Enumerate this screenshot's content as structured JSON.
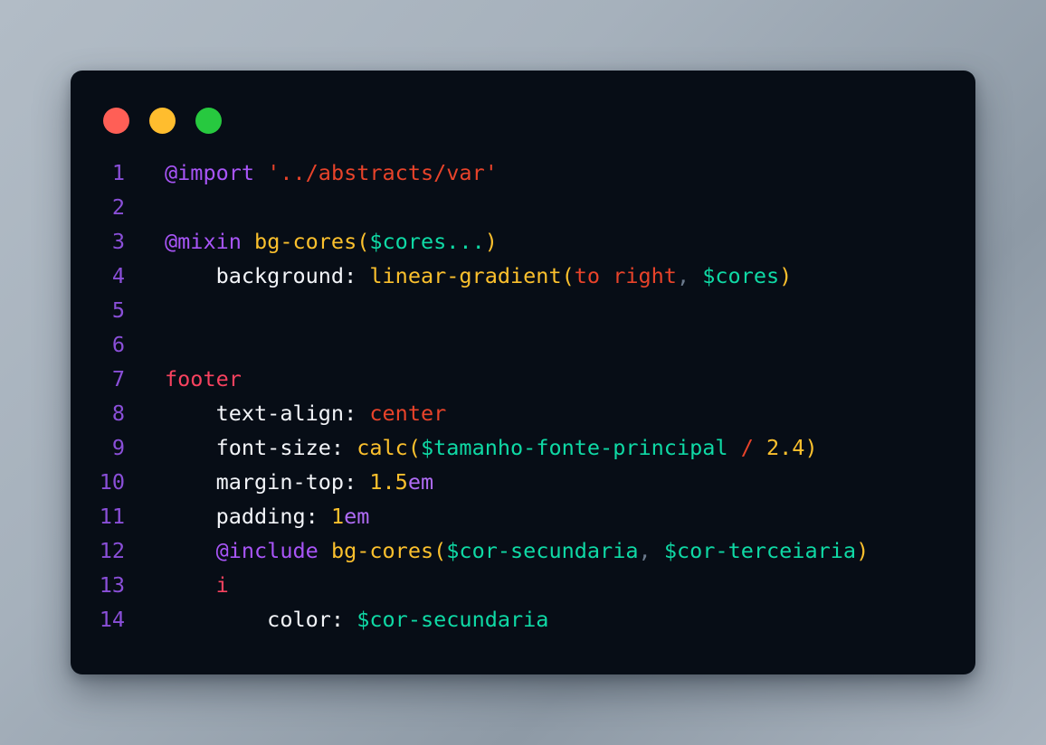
{
  "window": {
    "dots": [
      {
        "name": "close-dot",
        "color": "#ff5f56"
      },
      {
        "name": "minimize-dot",
        "color": "#ffbd2e"
      },
      {
        "name": "maximize-dot",
        "color": "#27c93f"
      }
    ],
    "background_color": "#070d16",
    "page_background": "#a6b1bc"
  },
  "editor": {
    "language": "scss",
    "line_count": 14,
    "line_numbers": [
      "1",
      "2",
      "3",
      "4",
      "5",
      "6",
      "7",
      "8",
      "9",
      "10",
      "11",
      "12",
      "13",
      "14"
    ],
    "lines": [
      {
        "number": "1",
        "text": "@import '../abstracts/var'",
        "tokens": [
          {
            "t": "@import",
            "c": "t-at"
          },
          {
            "t": " ",
            "c": "t-plain"
          },
          {
            "t": "'../abstracts/var'",
            "c": "t-str"
          }
        ]
      },
      {
        "number": "2",
        "text": "",
        "tokens": []
      },
      {
        "number": "3",
        "text": "@mixin bg-cores($cores...)",
        "tokens": [
          {
            "t": "@mixin",
            "c": "t-at"
          },
          {
            "t": " ",
            "c": "t-plain"
          },
          {
            "t": "bg-cores",
            "c": "t-fn"
          },
          {
            "t": "(",
            "c": "t-punct"
          },
          {
            "t": "$cores...",
            "c": "t-var"
          },
          {
            "t": ")",
            "c": "t-punct"
          }
        ]
      },
      {
        "number": "4",
        "text": "    background: linear-gradient(to right, $cores)",
        "tokens": [
          {
            "t": "    background: ",
            "c": "t-plain"
          },
          {
            "t": "linear-gradient",
            "c": "t-fn"
          },
          {
            "t": "(",
            "c": "t-punct"
          },
          {
            "t": "to right",
            "c": "t-val"
          },
          {
            "t": ",",
            "c": "t-comma"
          },
          {
            "t": " ",
            "c": "t-plain"
          },
          {
            "t": "$cores",
            "c": "t-var"
          },
          {
            "t": ")",
            "c": "t-punct"
          }
        ]
      },
      {
        "number": "5",
        "text": "",
        "tokens": []
      },
      {
        "number": "6",
        "text": "",
        "tokens": []
      },
      {
        "number": "7",
        "text": "footer",
        "tokens": [
          {
            "t": "footer",
            "c": "t-sel"
          }
        ]
      },
      {
        "number": "8",
        "text": "    text-align: center",
        "tokens": [
          {
            "t": "    text-align: ",
            "c": "t-plain"
          },
          {
            "t": "center",
            "c": "t-val"
          }
        ]
      },
      {
        "number": "9",
        "text": "    font-size: calc($tamanho-fonte-principal / 2.4)",
        "tokens": [
          {
            "t": "    font-size: ",
            "c": "t-plain"
          },
          {
            "t": "calc",
            "c": "t-fn"
          },
          {
            "t": "(",
            "c": "t-punct"
          },
          {
            "t": "$tamanho-fonte-principal",
            "c": "t-var"
          },
          {
            "t": " ",
            "c": "t-plain"
          },
          {
            "t": "/",
            "c": "t-op"
          },
          {
            "t": " ",
            "c": "t-plain"
          },
          {
            "t": "2.4",
            "c": "t-num"
          },
          {
            "t": ")",
            "c": "t-punct"
          }
        ]
      },
      {
        "number": "10",
        "text": "    margin-top: 1.5em",
        "tokens": [
          {
            "t": "    margin-top: ",
            "c": "t-plain"
          },
          {
            "t": "1.5",
            "c": "t-num"
          },
          {
            "t": "em",
            "c": "t-unit"
          }
        ]
      },
      {
        "number": "11",
        "text": "    padding: 1em",
        "tokens": [
          {
            "t": "    padding: ",
            "c": "t-plain"
          },
          {
            "t": "1",
            "c": "t-num"
          },
          {
            "t": "em",
            "c": "t-unit"
          }
        ]
      },
      {
        "number": "12",
        "text": "    @include bg-cores($cor-secundaria, $cor-terceiaria)",
        "tokens": [
          {
            "t": "    ",
            "c": "t-plain"
          },
          {
            "t": "@include",
            "c": "t-at"
          },
          {
            "t": " ",
            "c": "t-plain"
          },
          {
            "t": "bg-cores",
            "c": "t-fn"
          },
          {
            "t": "(",
            "c": "t-punct"
          },
          {
            "t": "$cor-secundaria",
            "c": "t-var"
          },
          {
            "t": ",",
            "c": "t-comma"
          },
          {
            "t": " ",
            "c": "t-plain"
          },
          {
            "t": "$cor-terceiaria",
            "c": "t-var"
          },
          {
            "t": ")",
            "c": "t-punct"
          }
        ]
      },
      {
        "number": "13",
        "text": "    i",
        "tokens": [
          {
            "t": "    ",
            "c": "t-plain"
          },
          {
            "t": "i",
            "c": "t-sel"
          }
        ]
      },
      {
        "number": "14",
        "text": "        color: $cor-secundaria",
        "tokens": [
          {
            "t": "        color: ",
            "c": "t-plain"
          },
          {
            "t": "$cor-secundaria",
            "c": "t-var"
          }
        ]
      }
    ],
    "token_colors": {
      "at_rule": "#a855f7",
      "string": "#e8432a",
      "function": "#fbc02d",
      "variable": "#0fd9a5",
      "punctuation": "#fbc02d",
      "plain": "#f2f4f8",
      "selector": "#f8425f",
      "value": "#e8432a",
      "number": "#fbc02d",
      "unit": "#b06cf5",
      "operator": "#e8432a",
      "comma": "#6b7a8d",
      "line_number": "#8a4fd8"
    }
  }
}
